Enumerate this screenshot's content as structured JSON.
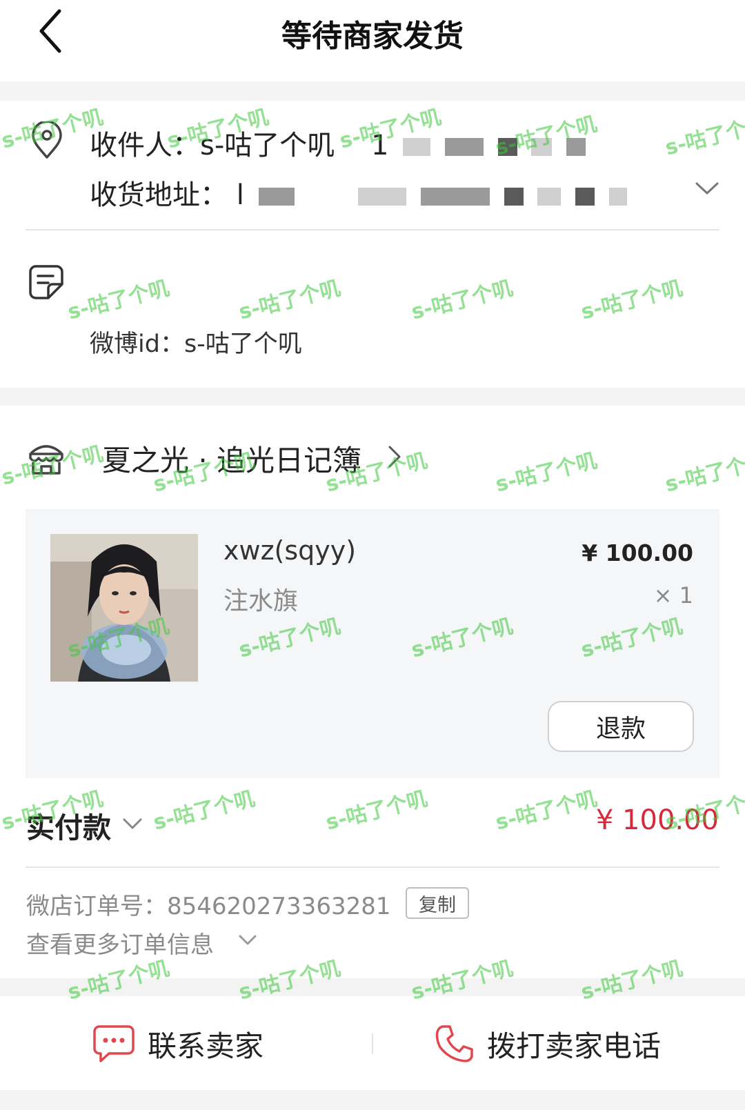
{
  "header": {
    "title": "等待商家发货"
  },
  "address": {
    "recipient": "收件人：s-咕了个叽",
    "phone_partial": "1",
    "address_label": "收货地址：",
    "address_partial": "l"
  },
  "note": {
    "weibo_id": "微博id：s-咕了个叽"
  },
  "shop": {
    "name": "夏之光 · 追光日记簿"
  },
  "item": {
    "name": "xwz(sqyy)",
    "price": "¥ 100.00",
    "spec": "注水旗",
    "quantity": "× 1",
    "refund_label": "退款"
  },
  "payment": {
    "label": "实付款",
    "amount": "¥ 100.00"
  },
  "order": {
    "number_text": "微店订单号：854620273363281",
    "copy_label": "复制",
    "more_info": "查看更多订单信息"
  },
  "actions": {
    "contact_seller": "联系卖家",
    "call_seller": "拨打卖家电话"
  },
  "watermark_text": "s-咕了个叽",
  "colors": {
    "price_red": "#d52a3c",
    "accent_red": "#e0474f"
  }
}
